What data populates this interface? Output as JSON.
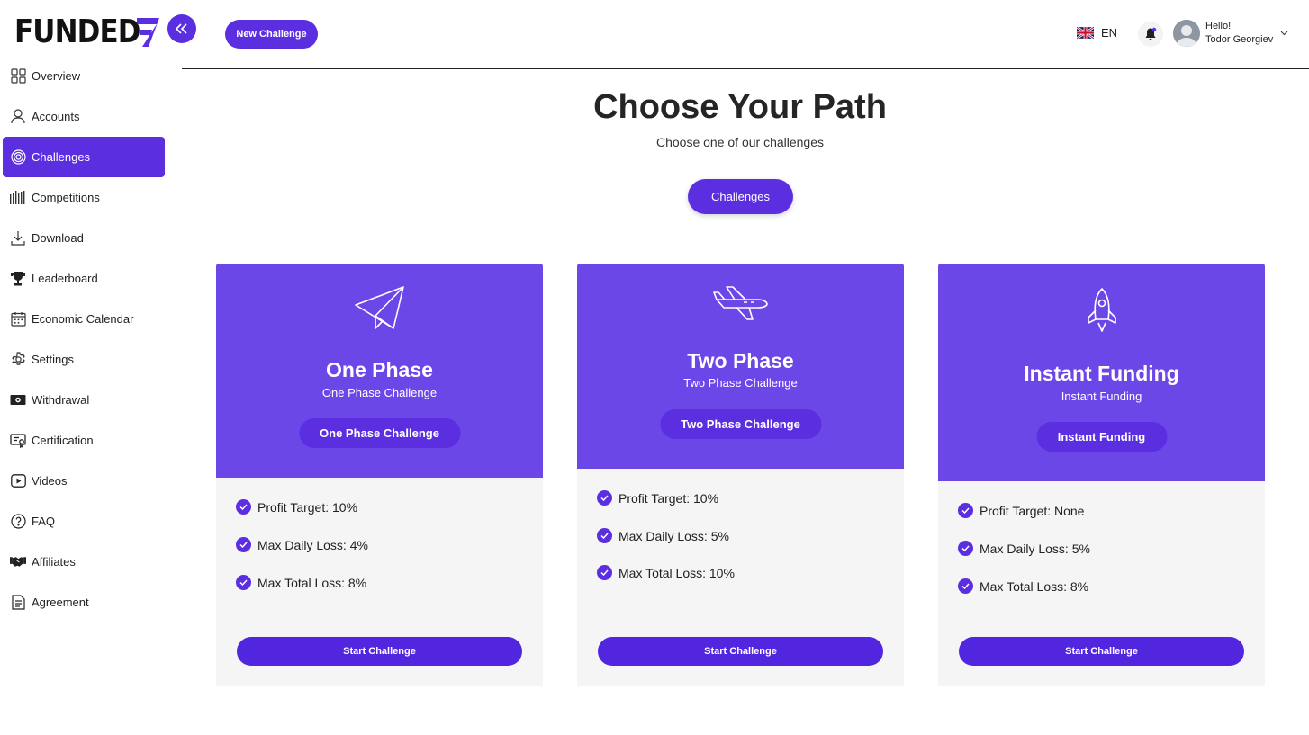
{
  "brand": {
    "logo_text": "FUNDED",
    "accent": "#5b2ee0",
    "card_accent": "#6c47e8"
  },
  "header": {
    "new_challenge_label": "New Challenge",
    "language": "EN",
    "greeting": "Hello!",
    "user_name": "Todor Georgiev"
  },
  "sidebar": {
    "items": [
      {
        "label": "Overview",
        "icon": "grid-icon"
      },
      {
        "label": "Accounts",
        "icon": "user-icon"
      },
      {
        "label": "Challenges",
        "icon": "target-icon",
        "active": true
      },
      {
        "label": "Competitions",
        "icon": "bars-icon"
      },
      {
        "label": "Download",
        "icon": "download-icon"
      },
      {
        "label": "Leaderboard",
        "icon": "trophy-icon"
      },
      {
        "label": "Economic Calendar",
        "icon": "calendar-icon"
      },
      {
        "label": "Settings",
        "icon": "gear-icon"
      },
      {
        "label": "Withdrawal",
        "icon": "cash-icon"
      },
      {
        "label": "Certification",
        "icon": "certificate-icon"
      },
      {
        "label": "Videos",
        "icon": "video-icon"
      },
      {
        "label": "FAQ",
        "icon": "question-icon"
      },
      {
        "label": "Affiliates",
        "icon": "handshake-icon"
      },
      {
        "label": "Agreement",
        "icon": "document-icon"
      }
    ]
  },
  "main": {
    "title": "Choose Your Path",
    "subtitle": "Choose one of our challenges",
    "tab_label": "Challenges",
    "cards": [
      {
        "title": "One Phase",
        "subtitle": "One Phase Challenge",
        "pill": "One Phase Challenge",
        "icon": "paper-plane-icon",
        "features": [
          "Profit Target: 10%",
          "Max Daily Loss: 4%",
          "Max Total Loss: 8%"
        ],
        "cta": "Start Challenge"
      },
      {
        "title": "Two Phase",
        "subtitle": "Two Phase Challenge",
        "pill": "Two Phase Challenge",
        "icon": "airplane-icon",
        "features": [
          "Profit Target: 10%",
          "Max Daily Loss: 5%",
          "Max Total Loss: 10%"
        ],
        "cta": "Start Challenge"
      },
      {
        "title": "Instant Funding",
        "subtitle": "Instant Funding",
        "pill": "Instant Funding",
        "icon": "rocket-icon",
        "features": [
          "Profit Target: None",
          "Max Daily Loss: 5%",
          "Max Total Loss: 8%"
        ],
        "cta": "Start Challenge"
      }
    ]
  }
}
